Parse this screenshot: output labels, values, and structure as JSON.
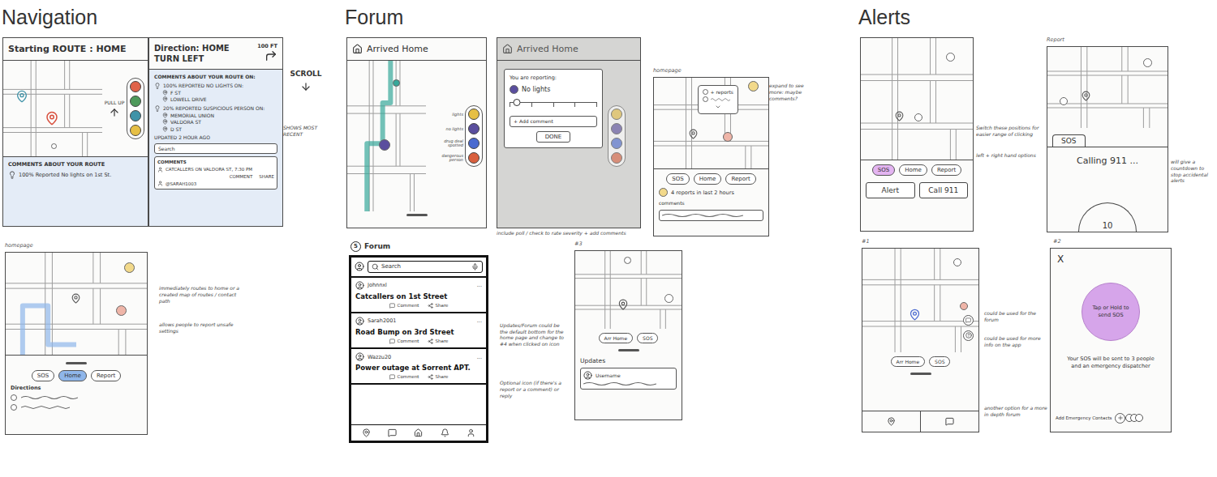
{
  "navigation": {
    "title": "Navigation",
    "start_screen": {
      "heading": "Starting ROUTE : HOME",
      "pull_label": "PULL UP",
      "legend": [
        {
          "color": "#e0634a"
        },
        {
          "color": "#4e9a5c"
        },
        {
          "color": "#3f93a8"
        },
        {
          "color": "#e6bf45"
        }
      ],
      "comments_title": "COMMENTS ABOUT YOUR ROUTE",
      "comment": "100% Reported No lights on 1st St."
    },
    "direction_screen": {
      "heading": "Direction: HOME",
      "instruction": "TURN LEFT",
      "distance": "100 FT",
      "comments_title": "COMMENTS ABOUT YOUR ROUTE ON:",
      "reports": [
        {
          "label": "100% REPORTED NO LIGHTS ON:",
          "streets": [
            "F ST",
            "LOWELL DRIVE"
          ]
        },
        {
          "label": "20% REPORTED SUSPICIOUS PERSON ON:",
          "streets": [
            "MEMORIAL UNION",
            "VALDORA ST",
            "D ST"
          ]
        }
      ],
      "updated": "UPDATED 2 HOUR AGO",
      "search_placeholder": "Search",
      "comments_tab": "COMMENTS",
      "comment_text": "CATCALLERS ON VALDORA ST, 7:30 PM",
      "comment_actions": [
        "COMMENT",
        "SHARE"
      ],
      "comment_user": "@SARAH1003"
    },
    "scroll_note": "SCROLL",
    "recent_note": "SHOWS MOST RECENT",
    "homepage": {
      "label": "homepage",
      "buttons": [
        {
          "label": "SOS",
          "selected": false
        },
        {
          "label": "Home",
          "selected": true
        },
        {
          "label": "Report",
          "selected": false
        }
      ],
      "directions_title": "Directions",
      "notes": [
        "immediately routes to home or a created map of routes / contact path",
        "allows people to report unsafe settings"
      ]
    }
  },
  "forum": {
    "title": "Forum",
    "arrived_screen": {
      "heading": "Arrived Home",
      "legend": [
        {
          "label": "lights",
          "color": "#e6bf45"
        },
        {
          "label": "no lights",
          "color": "#5a4e9e"
        },
        {
          "label": "drug deal spotted",
          "color": "#4a6ad0"
        },
        {
          "label": "dangerous person",
          "color": "#d9603e"
        }
      ]
    },
    "include_note": "include poll / check to rate severity + add comments",
    "report_screen": {
      "heading": "Arrived Home",
      "modal_title": "You are reporting:",
      "item": "No lights",
      "severity": {
        "level": 0.08
      },
      "comment_placeholder": "+ Add comment",
      "done": "DONE"
    },
    "homepage": {
      "label": "homepage",
      "popup": "+ reports",
      "buttons": [
        {
          "label": "SOS",
          "selected": false
        },
        {
          "label": "Home",
          "selected": false
        },
        {
          "label": "Report",
          "selected": false
        }
      ],
      "summary": "4 reports in last 2 hours",
      "comments": "comments",
      "note": "expand to see more: maybe comments?"
    },
    "forum_screen": {
      "number": "5",
      "label": "Forum",
      "search_placeholder": "Search",
      "post_menu": "...",
      "post_actions": [
        "Comment",
        "Share"
      ],
      "posts": [
        {
          "user": "Johnnxl",
          "title": "Catcallers on 1st Street"
        },
        {
          "user": "Sarah2001",
          "title": "Road Bump on 3rd Street"
        },
        {
          "user": "Wazzu20",
          "title": "Power outage at Sorrent APT."
        }
      ]
    },
    "notes": [
      "Updates/Forum could be the default bottom for the home page and change to #4 when clicked on icon",
      "Optional icon (if there's a report or a comment) or reply"
    ],
    "updates_screen": {
      "label": "#3",
      "buttons": [
        {
          "label": "Arr Home",
          "selected": false
        },
        {
          "label": "SOS",
          "selected": false
        }
      ],
      "updates_title": "Updates",
      "user": "Username"
    }
  },
  "alerts": {
    "title": "Alerts",
    "sos_screen": {
      "buttons": [
        {
          "label": "SOS",
          "selected": true
        },
        {
          "label": "Home",
          "selected": false
        },
        {
          "label": "Report",
          "selected": false
        }
      ],
      "actions": [
        "Alert",
        "Call 911"
      ],
      "notes": [
        "Switch these positions for easier range of clicking",
        "left + right hand options"
      ]
    },
    "calling_screen": {
      "label": "Report",
      "tab": "SOS",
      "status": "Calling 911 ...",
      "countdown": "10",
      "note": "will give a countdown to stop accidental alerts"
    },
    "option_one": {
      "label": "#1",
      "buttons": [
        {
          "label": "Arr Home",
          "selected": false
        },
        {
          "label": "SOS",
          "selected": false
        }
      ],
      "notes": [
        "could be used for the forum",
        "could be used for more info on the app",
        "another option for a more in depth forum"
      ]
    },
    "option_two": {
      "label": "#2",
      "close": "X",
      "sos_button": "Tap or Hold to send SOS",
      "message": "Your SOS will be sent to 3 people and an emergency dispatcher",
      "contacts": "Add Emergency Contacts"
    }
  }
}
